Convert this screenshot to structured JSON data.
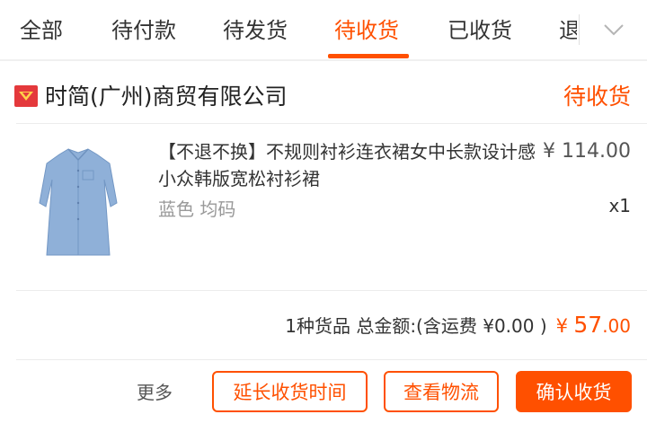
{
  "tabs": [
    {
      "label": "全部"
    },
    {
      "label": "待付款"
    },
    {
      "label": "待发货"
    },
    {
      "label": "待收货"
    },
    {
      "label": "已收货"
    },
    {
      "label": "退"
    }
  ],
  "active_tab": "待收货",
  "order": {
    "shop_name": "时简(广州)商贸有限公司",
    "status": "待收货",
    "item": {
      "title": "【不退不换】不规则衬衫连衣裙女中长款设计感小众韩版宽松衬衫裙",
      "price": "¥ 114.00",
      "spec": "蓝色 均码",
      "quantity": "x1"
    },
    "summary": {
      "text": "1种货品 总金额:(含运费 ¥0.00 )",
      "currency": "¥",
      "amount_int": "57",
      "amount_dec": ".00"
    },
    "actions": {
      "more": "更多",
      "extend": "延长收货时间",
      "logistics": "查看物流",
      "confirm": "确认收货"
    }
  },
  "colors": {
    "accent": "#ff5000",
    "shop_icon": "#e4393c",
    "text": "#333333",
    "muted": "#999999",
    "divider": "#ececec"
  }
}
